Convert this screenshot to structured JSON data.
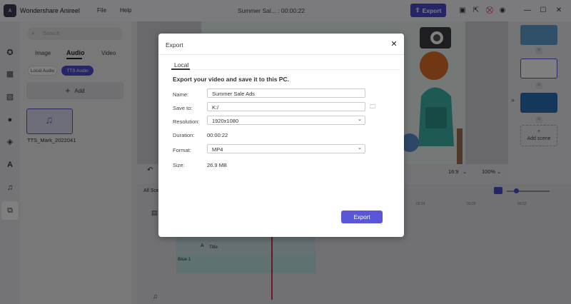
{
  "app": {
    "name": "Wondershare Anireel",
    "logo_text": "A",
    "doc_title": "Summer Sal... : 00:00:22"
  },
  "menu": {
    "file": "File",
    "help": "Help"
  },
  "toolbar": {
    "export_label": "Export"
  },
  "left_panel": {
    "search_placeholder": "Search",
    "tabs": {
      "image": "Image",
      "audio": "Audio",
      "video": "Video"
    },
    "chips": {
      "local_audio": "Local Audio",
      "tts_audio": "TTS Audio"
    },
    "add_label": "Add",
    "audio_item": "TTS_Mark_2022041"
  },
  "preview": {
    "ratio": "16:9",
    "zoom": "100%"
  },
  "scenes": {
    "add_scene": "Add scene"
  },
  "timeline": {
    "all_scenes": "All Sce",
    "ruler": [
      "00:18",
      "00:20",
      "00:22"
    ],
    "title_track": "Title",
    "blue_track": "Blue 1"
  },
  "modal": {
    "title": "Export",
    "tab_local": "Local",
    "heading": "Export your video and save it to this PC.",
    "name_label": "Name:",
    "name_value": "Summer Sale Ads",
    "save_label": "Save to:",
    "save_value": "K:/",
    "resolution_label": "Resolution:",
    "resolution_value": "1920x1080",
    "duration_label": "Duration:",
    "duration_value": "00:00:22",
    "format_label": "Format:",
    "format_value": "MP4",
    "size_label": "Size:",
    "size_value": "26.9 MB",
    "export_button": "Export"
  }
}
